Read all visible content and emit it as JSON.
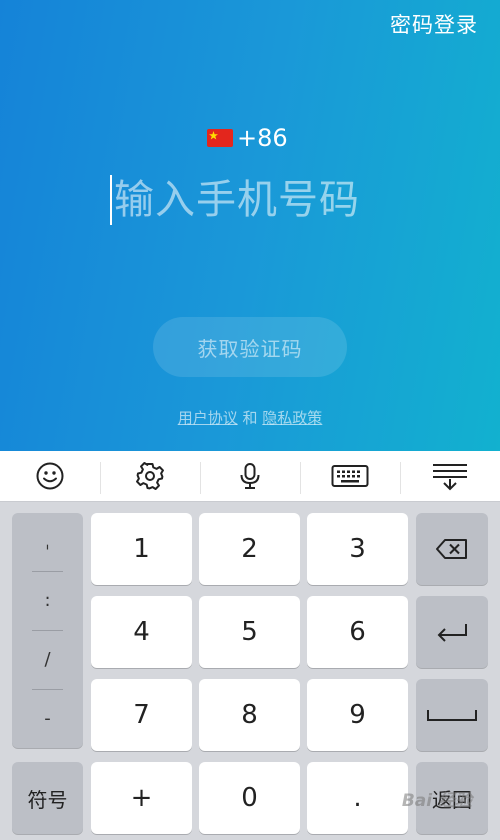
{
  "header": {
    "password_login": "密码登录"
  },
  "country": {
    "code": "+86",
    "flag_icon": "china-flag-icon"
  },
  "phone": {
    "placeholder": "输入手机号码"
  },
  "get_code_label": "获取验证码",
  "agreements": {
    "user_agreement": "用户协议",
    "and": "和",
    "privacy_policy": "隐私政策"
  },
  "toolbar": {
    "icons": [
      "emoji-icon",
      "gear-icon",
      "microphone-icon",
      "keyboard-icon",
      "collapse-keyboard-icon"
    ]
  },
  "keyboard": {
    "symbols": [
      "ˌ",
      ":",
      "/",
      "-"
    ],
    "digits": [
      "1",
      "2",
      "3",
      "4",
      "5",
      "6",
      "7",
      "8",
      "9"
    ],
    "symbol_key": "符号",
    "plus": "+",
    "zero": "0",
    "dot": ".",
    "return_key": "返回"
  },
  "watermark": "Bai 经验",
  "colors": {
    "gradient_start": "#1583d8",
    "gradient_end": "#12b1cf",
    "key_bg": "#ffffff",
    "key_dark": "#bcbfc6"
  }
}
